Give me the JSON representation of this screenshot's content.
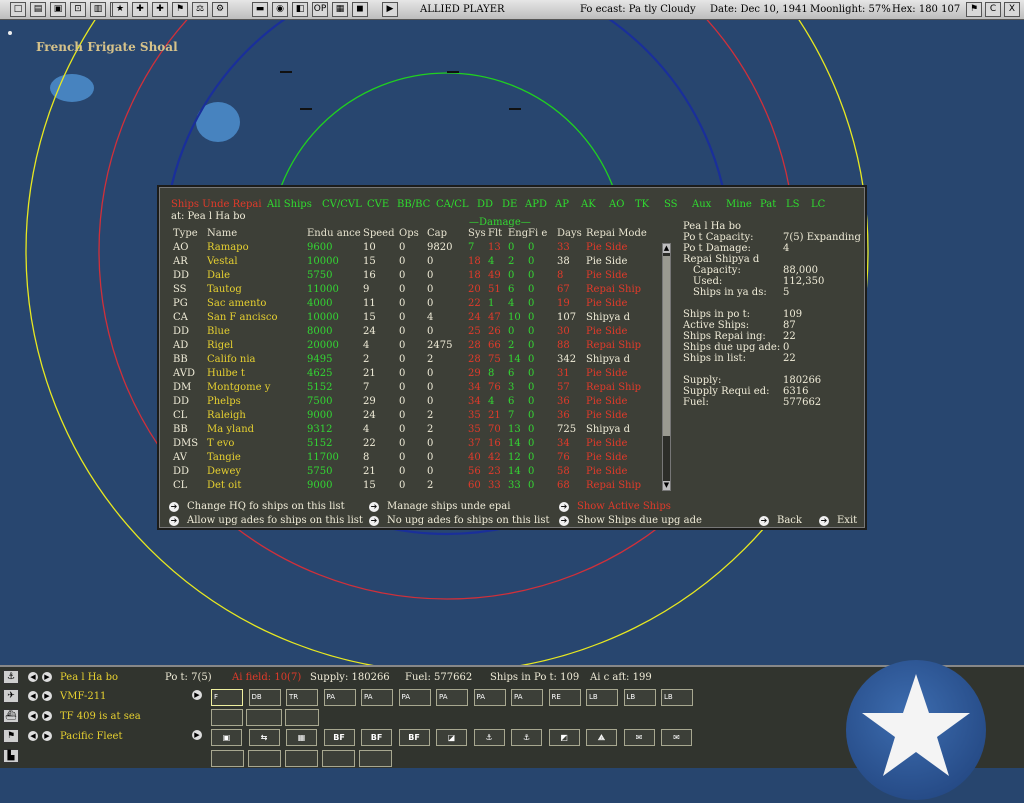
{
  "topbar": {
    "buttons": [
      "□",
      "▤",
      "▣",
      "⊡",
      "▥",
      "?",
      "★",
      "✚",
      "✚",
      "⚑",
      "⚖",
      "⚙",
      "▬",
      "◉",
      "◧",
      "OP",
      "▦",
      "◼",
      "▶"
    ],
    "player": "ALLIED PLAYER",
    "forecast": "Fo ecast: Pa tly Cloudy",
    "date": "Date: Dec 10, 1941",
    "moonlight": "Moonlight: 57%",
    "hex": "Hex: 180 107",
    "right_buttons": [
      "⚑",
      "C",
      "X"
    ]
  },
  "map": {
    "location": "French Frigate Shoal"
  },
  "dialog": {
    "title": "Ships Unde Repai",
    "location": "at: Pea l Ha bo",
    "filters": [
      "All Ships",
      "CV/CVL",
      "CVE",
      "BB/BC",
      "CA/CL",
      "DD",
      "DE",
      "APD",
      "AP",
      "AK",
      "AO",
      "TK",
      "SS",
      "Aux",
      "Mine",
      "Pat",
      "LS",
      "LC"
    ],
    "damage_header": "—Damage—",
    "columns": [
      "Type",
      "Name",
      "Endu ance",
      "Speed",
      "Ops",
      "Cap",
      "Sys",
      "Flt",
      "Eng",
      "Fi e",
      "Days",
      "Repai Mode"
    ],
    "rows": [
      {
        "type": "AO",
        "name": "Ramapo",
        "end": "9600",
        "spd": "10",
        "ops": "0",
        "cap": "9820",
        "sys": "7",
        "flt": "13",
        "eng": "0",
        "fire": "0",
        "days": "33",
        "mode": "Pie Side",
        "red": true,
        "sysc": "green",
        "fltc": "red"
      },
      {
        "type": "AR",
        "name": "Vestal",
        "end": "10000",
        "spd": "15",
        "ops": "0",
        "cap": "0",
        "sys": "18",
        "flt": "4",
        "eng": "2",
        "fire": "0",
        "days": "38",
        "mode": "Pie Side",
        "red": false,
        "sysc": "red",
        "fltc": "green"
      },
      {
        "type": "DD",
        "name": "Dale",
        "end": "5750",
        "spd": "16",
        "ops": "0",
        "cap": "0",
        "sys": "18",
        "flt": "49",
        "eng": "0",
        "fire": "0",
        "days": "8",
        "mode": "Pie Side",
        "red": true,
        "sysc": "red",
        "fltc": "red"
      },
      {
        "type": "SS",
        "name": "Tautog",
        "end": "11000",
        "spd": "9",
        "ops": "0",
        "cap": "0",
        "sys": "20",
        "flt": "51",
        "eng": "6",
        "fire": "0",
        "days": "67",
        "mode": "Repai Ship",
        "red": true,
        "sysc": "red",
        "fltc": "red"
      },
      {
        "type": "PG",
        "name": "Sac amento",
        "end": "4000",
        "spd": "11",
        "ops": "0",
        "cap": "0",
        "sys": "22",
        "flt": "1",
        "eng": "4",
        "fire": "0",
        "days": "19",
        "mode": "Pie Side",
        "red": true,
        "sysc": "red",
        "fltc": "green"
      },
      {
        "type": "CA",
        "name": "San F ancisco",
        "end": "10000",
        "spd": "15",
        "ops": "0",
        "cap": "4",
        "sys": "24",
        "flt": "47",
        "eng": "10",
        "fire": "0",
        "days": "107",
        "mode": "Shipya d",
        "red": false,
        "sysc": "red",
        "fltc": "red"
      },
      {
        "type": "DD",
        "name": "Blue",
        "end": "8000",
        "spd": "24",
        "ops": "0",
        "cap": "0",
        "sys": "25",
        "flt": "26",
        "eng": "0",
        "fire": "0",
        "days": "30",
        "mode": "Pie Side",
        "red": true,
        "sysc": "red",
        "fltc": "red"
      },
      {
        "type": "AD",
        "name": "Rigel",
        "end": "20000",
        "spd": "4",
        "ops": "0",
        "cap": "2475",
        "sys": "28",
        "flt": "66",
        "eng": "2",
        "fire": "0",
        "days": "88",
        "mode": "Repai Ship",
        "red": true,
        "sysc": "red",
        "fltc": "red"
      },
      {
        "type": "BB",
        "name": "Califo nia",
        "end": "9495",
        "spd": "2",
        "ops": "0",
        "cap": "2",
        "sys": "28",
        "flt": "75",
        "eng": "14",
        "fire": "0",
        "days": "342",
        "mode": "Shipya d",
        "red": false,
        "sysc": "red",
        "fltc": "red"
      },
      {
        "type": "AVD",
        "name": "Hulbe t",
        "end": "4625",
        "spd": "21",
        "ops": "0",
        "cap": "0",
        "sys": "29",
        "flt": "8",
        "eng": "6",
        "fire": "0",
        "days": "31",
        "mode": "Pie Side",
        "red": true,
        "sysc": "red",
        "fltc": "green"
      },
      {
        "type": "DM",
        "name": "Montgome y",
        "end": "5152",
        "spd": "7",
        "ops": "0",
        "cap": "0",
        "sys": "34",
        "flt": "76",
        "eng": "3",
        "fire": "0",
        "days": "57",
        "mode": "Repai Ship",
        "red": true,
        "sysc": "red",
        "fltc": "red"
      },
      {
        "type": "DD",
        "name": "Phelps",
        "end": "7500",
        "spd": "29",
        "ops": "0",
        "cap": "0",
        "sys": "34",
        "flt": "4",
        "eng": "6",
        "fire": "0",
        "days": "36",
        "mode": "Pie Side",
        "red": true,
        "sysc": "red",
        "fltc": "green"
      },
      {
        "type": "CL",
        "name": "Raleigh",
        "end": "9000",
        "spd": "24",
        "ops": "0",
        "cap": "2",
        "sys": "35",
        "flt": "21",
        "eng": "7",
        "fire": "0",
        "days": "36",
        "mode": "Pie Side",
        "red": true,
        "sysc": "red",
        "fltc": "red"
      },
      {
        "type": "BB",
        "name": "Ma yland",
        "end": "9312",
        "spd": "4",
        "ops": "0",
        "cap": "2",
        "sys": "35",
        "flt": "70",
        "eng": "13",
        "fire": "0",
        "days": "725",
        "mode": "Shipya d",
        "red": false,
        "sysc": "red",
        "fltc": "red"
      },
      {
        "type": "DMS",
        "name": "T evo",
        "end": "5152",
        "spd": "22",
        "ops": "0",
        "cap": "0",
        "sys": "37",
        "flt": "16",
        "eng": "14",
        "fire": "0",
        "days": "34",
        "mode": "Pie Side",
        "red": true,
        "sysc": "red",
        "fltc": "red"
      },
      {
        "type": "AV",
        "name": "Tangie",
        "end": "11700",
        "spd": "8",
        "ops": "0",
        "cap": "0",
        "sys": "40",
        "flt": "42",
        "eng": "12",
        "fire": "0",
        "days": "76",
        "mode": "Pie Side",
        "red": true,
        "sysc": "red",
        "fltc": "red"
      },
      {
        "type": "DD",
        "name": "Dewey",
        "end": "5750",
        "spd": "21",
        "ops": "0",
        "cap": "0",
        "sys": "56",
        "flt": "23",
        "eng": "14",
        "fire": "0",
        "days": "58",
        "mode": "Pie Side",
        "red": true,
        "sysc": "red",
        "fltc": "red"
      },
      {
        "type": "CL",
        "name": "Det oit",
        "end": "9000",
        "spd": "15",
        "ops": "0",
        "cap": "2",
        "sys": "60",
        "flt": "33",
        "eng": "33",
        "fire": "0",
        "days": "68",
        "mode": "Repai Ship",
        "red": true,
        "sysc": "red",
        "fltc": "red"
      }
    ],
    "scroll_up": "▲",
    "scroll_down": "▼",
    "info": [
      {
        "label": "Pea l Ha bo",
        "value": ""
      },
      {
        "label": "Po t Capacity:",
        "value": "7(5) Expanding"
      },
      {
        "label": "Po t Damage:",
        "value": "4"
      },
      {
        "label": "Repai Shipya d",
        "value": ""
      },
      {
        "label": "Capacity:",
        "value": "88,000"
      },
      {
        "label": "Used:",
        "value": "112,350"
      },
      {
        "label": "Ships in ya ds:",
        "value": "5"
      },
      {
        "label": "Ships in po t:",
        "value": "109"
      },
      {
        "label": "Active Ships:",
        "value": "87"
      },
      {
        "label": "Ships Repai ing:",
        "value": "22"
      },
      {
        "label": "Ships due upg ade:",
        "value": "0"
      },
      {
        "label": "Ships in list:",
        "value": "22"
      },
      {
        "label": "Supply:",
        "value": "180266"
      },
      {
        "label": "Supply Requi ed:",
        "value": "6316"
      },
      {
        "label": "Fuel:",
        "value": "577662"
      }
    ],
    "actions": {
      "change_hq": "Change HQ fo ships on this list",
      "allow_upgrades": "Allow upg ades fo ships on this list",
      "manage_ships": "Manage ships unde epai",
      "no_upgrades": "No upg ades fo ships on this list",
      "show_active": "Show Active Ships",
      "show_upgrade": "Show Ships due upg ade",
      "back": "Back",
      "exit": "Exit",
      "arrow": "➔"
    }
  },
  "bottom": {
    "row1": {
      "base": "Pea l Ha bo",
      "port": "Po t: 7(5)",
      "airfield": "Ai field: 10(7)",
      "supply": "Supply: 180266",
      "fuel": "Fuel: 577662",
      "ships": "Ships in Po t: 109",
      "aircraft": "Ai c aft: 199"
    },
    "row2": {
      "unit": "VMF-211"
    },
    "row3": {
      "unit": "TF 409 is at sea"
    },
    "row4": {
      "unit": "Pacific Fleet"
    },
    "air_slots": [
      "F",
      "DB",
      "TR",
      "PA",
      "PA",
      "PA",
      "PA",
      "PA",
      "PA",
      "RE",
      "LB",
      "LB",
      "LB"
    ],
    "cmd_buttons": [
      "▣",
      "⇆",
      "▦",
      "BF",
      "BF",
      "BF",
      "◪",
      "⚓",
      "⚓",
      "◩",
      "⟁",
      "✉",
      "✉"
    ],
    "left_icons": [
      "⚓",
      "✈",
      "⛴",
      "⚑",
      "▙"
    ],
    "nav": {
      "prev": "◀",
      "next": "▶"
    }
  }
}
